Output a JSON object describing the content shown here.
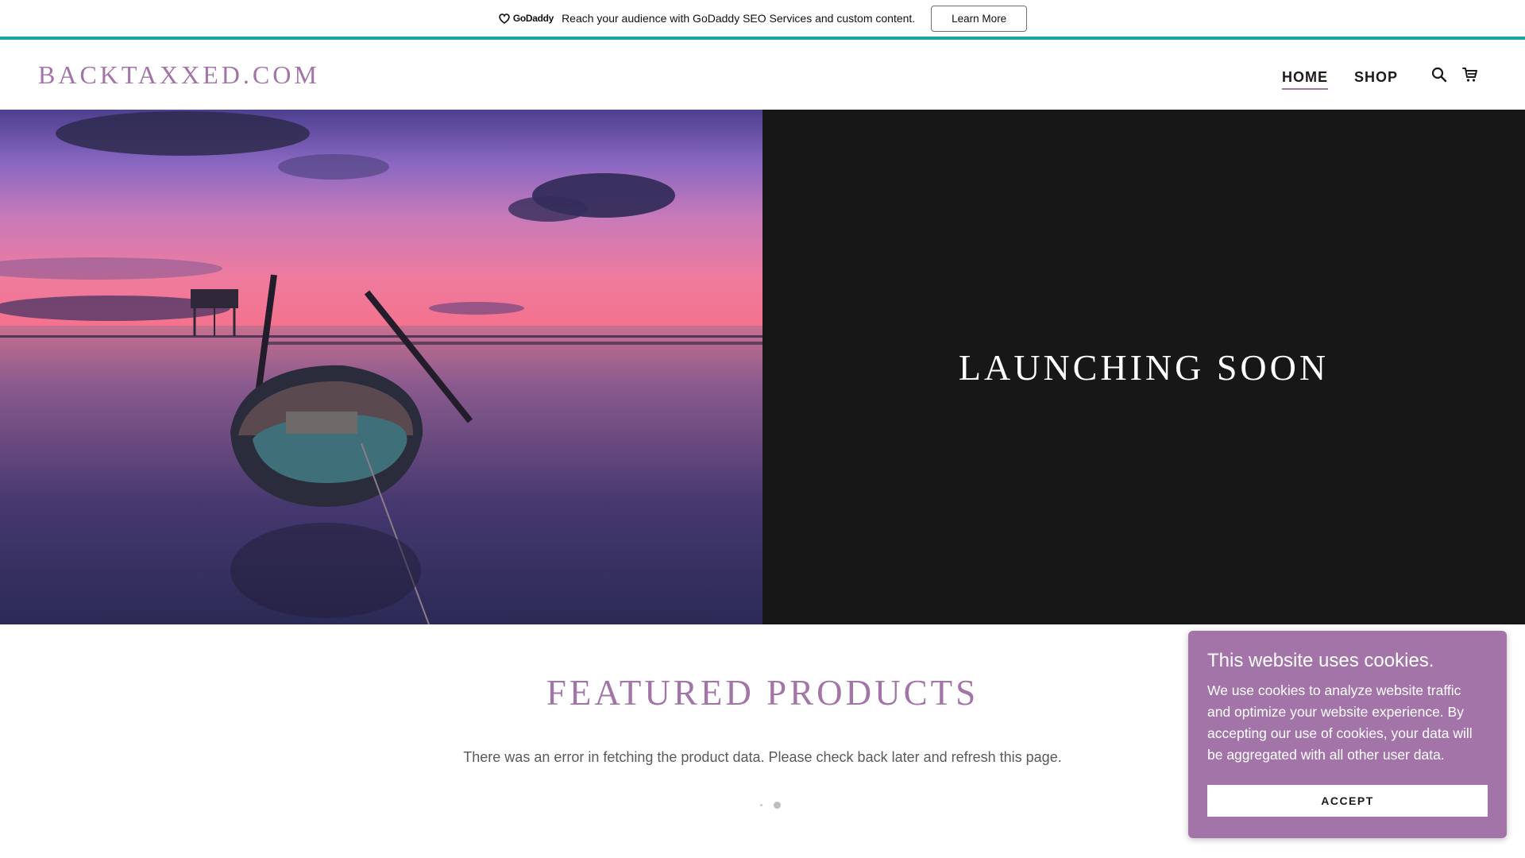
{
  "promo": {
    "brand": "GoDaddy",
    "text": "Reach your audience with GoDaddy SEO Services and custom content.",
    "button_label": "Learn More",
    "accent_line_color": "#1ba4a6"
  },
  "header": {
    "site_title": "BACKTAXXED.COM",
    "nav": [
      {
        "label": "HOME",
        "active": true
      },
      {
        "label": "SHOP",
        "active": false
      }
    ],
    "icons": [
      "search-icon",
      "cart-icon"
    ]
  },
  "hero": {
    "heading": "LAUNCHING SOON",
    "image": "sunset-boat-on-lake"
  },
  "featured": {
    "title": "FEATURED PRODUCTS",
    "message": "There was an error in fetching the product data. Please check back later and refresh this page."
  },
  "cookie": {
    "title": "This website uses cookies.",
    "body": "We use cookies to analyze website traffic and optimize your website experience. By accepting our use of cookies, your data will be aggregated with all other user data.",
    "button_label": "ACCEPT"
  },
  "colors": {
    "accent": "#a374a8",
    "hero_dark": "#171717",
    "teal": "#1ba4a6"
  }
}
